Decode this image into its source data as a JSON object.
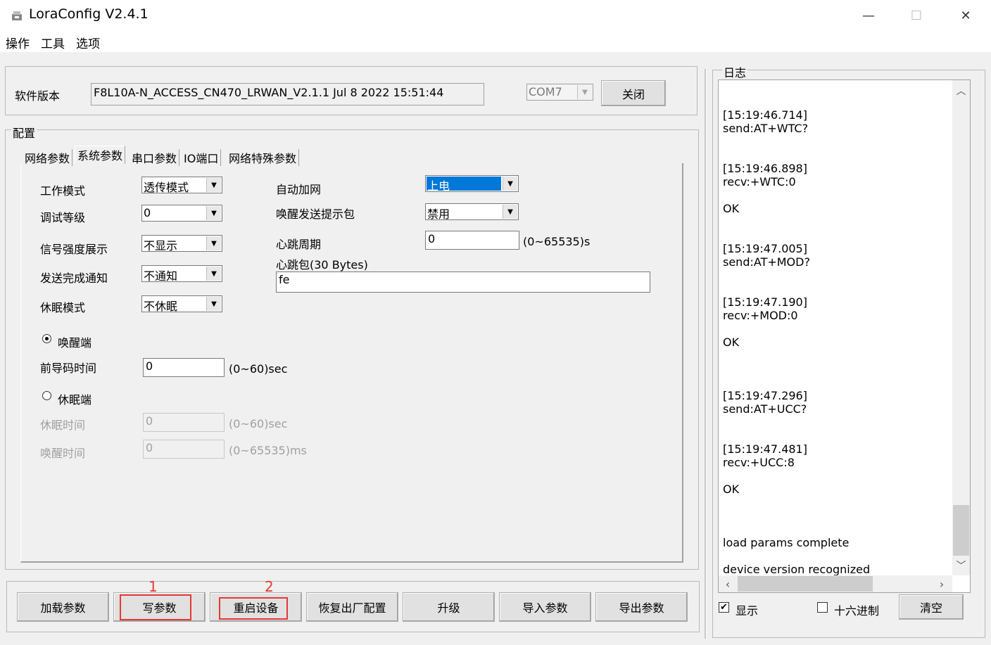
{
  "window": {
    "title": "LoraConfig V2.4.1",
    "min": "—",
    "max": "☐",
    "close": "✕"
  },
  "menu": [
    "操作",
    "工具",
    "选项"
  ],
  "version": {
    "label": "软件版本",
    "value": "F8L10A-N_ACCESS_CN470_LRWAN_V2.1.1 Jul  8 2022 15:51:44",
    "port": "COM7",
    "close_btn": "关闭"
  },
  "config": {
    "group": "配置",
    "tabs": [
      "网络参数",
      "系统参数",
      "串口参数",
      "IO端口",
      "网络特殊参数"
    ],
    "work_mode": {
      "label": "工作模式",
      "value": "透传模式"
    },
    "debug_level": {
      "label": "调试等级",
      "value": "0"
    },
    "signal_display": {
      "label": "信号强度展示",
      "value": "不显示"
    },
    "send_notify": {
      "label": "发送完成通知",
      "value": "不通知"
    },
    "sleep_mode": {
      "label": "休眠模式",
      "value": "不休眠"
    },
    "auto_join": {
      "label": "自动加网",
      "value": "上电"
    },
    "wake_packet": {
      "label": "唤醒发送提示包",
      "value": "禁用"
    },
    "heartbeat_period": {
      "label": "心跳周期",
      "value": "0",
      "unit": "(0~65535)s"
    },
    "heartbeat_packet": {
      "label": "心跳包(30 Bytes)",
      "value": "fe"
    },
    "wake_end": {
      "label": "唤醒端"
    },
    "preamble": {
      "label": "前导码时间",
      "value": "0",
      "unit": "(0~60)sec"
    },
    "sleep_end": {
      "label": "休眠端"
    },
    "sleep_time": {
      "label": "休眠时间",
      "value": "0",
      "unit": "(0~60)sec"
    },
    "wake_time": {
      "label": "唤醒时间",
      "value": "0",
      "unit": "(0~65535)ms"
    }
  },
  "buttons": [
    "加载参数",
    "写参数",
    "重启设备",
    "恢复出厂配置",
    "升级",
    "导入参数",
    "导出参数"
  ],
  "annotations": [
    "1",
    "2"
  ],
  "log": {
    "group": "日志",
    "lines": [
      "[15:19:46.714]",
      "send:AT+WTC?",
      "",
      "",
      "[15:19:46.898]",
      "recv:+WTC:0",
      "",
      "OK",
      "",
      "",
      "[15:19:47.005]",
      "send:AT+MOD?",
      "",
      "",
      "[15:19:47.190]",
      "recv:+MOD:0",
      "",
      "OK",
      "",
      "",
      "",
      "[15:19:47.296]",
      "send:AT+UCC?",
      "",
      "",
      "[15:19:47.481]",
      "recv:+UCC:8",
      "",
      "OK",
      "",
      "",
      "",
      "load params complete",
      "",
      "device version recognized"
    ],
    "show_label": "显示",
    "hex_label": "十六进制",
    "clear_btn": "清空"
  }
}
